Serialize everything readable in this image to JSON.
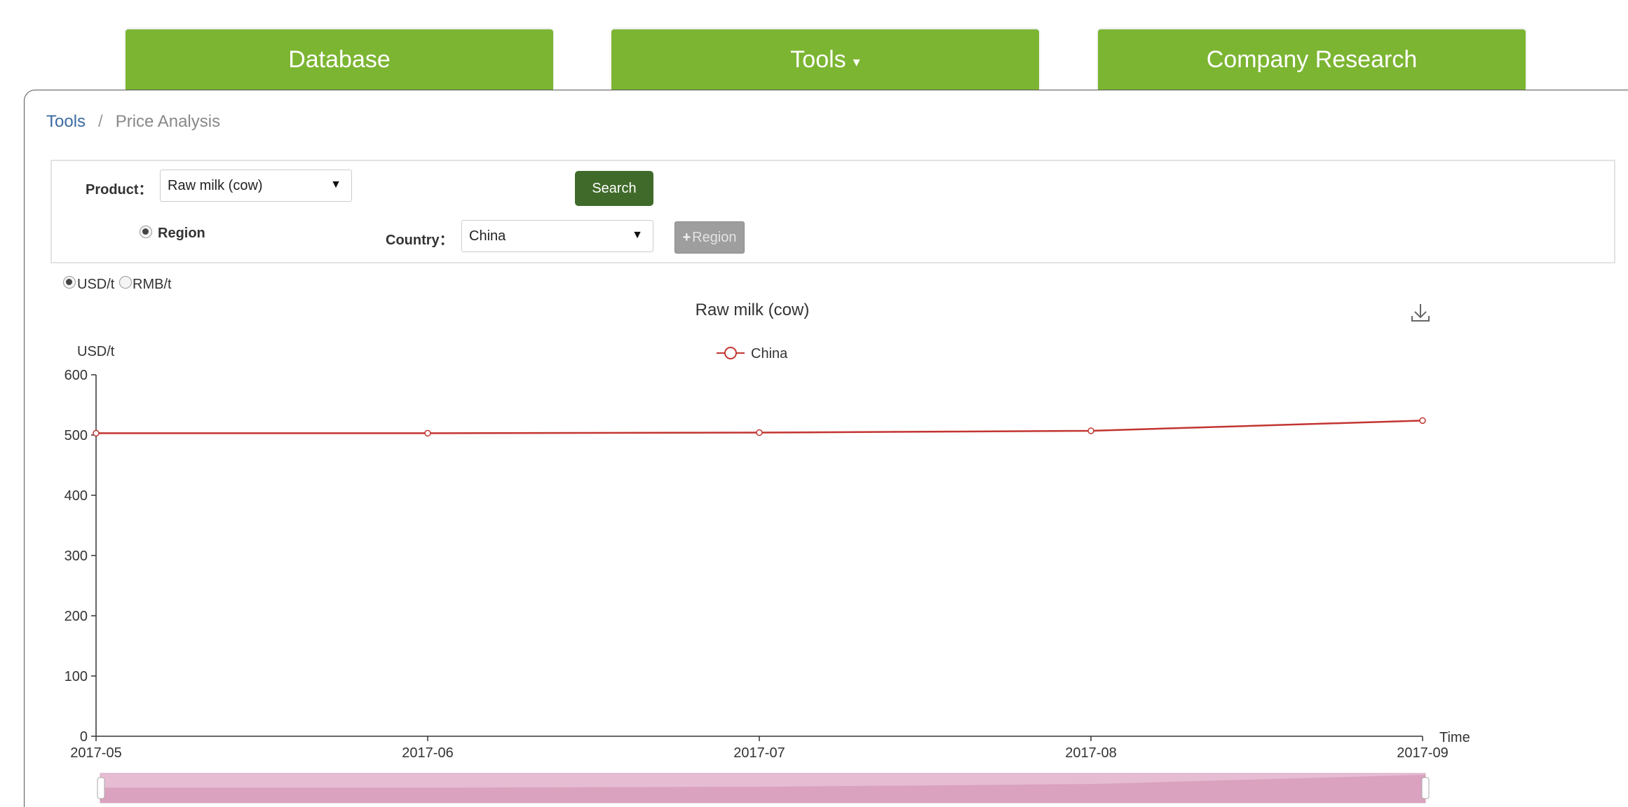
{
  "nav": {
    "database": "Database",
    "tools": "Tools",
    "company_research": "Company Research"
  },
  "breadcrumb": {
    "parent": "Tools",
    "separator": "/",
    "current": "Price Analysis"
  },
  "filters": {
    "product_label": "Product：",
    "product_value": "Raw milk (cow)",
    "search_button": "Search",
    "region_label": "Region",
    "country_label": "Country：",
    "country_value": "China",
    "add_region_button": "Region"
  },
  "units": {
    "usd": "USD/t",
    "rmb": "RMB/t",
    "selected": "USD/t"
  },
  "colors": {
    "nav_green": "#7cb532",
    "search_green": "#3f6a2a",
    "series_red": "#c23531",
    "zoom_fill": "#e6bcd3"
  },
  "chart_data": {
    "type": "line",
    "title": "Raw milk (cow)",
    "xlabel": "Time",
    "ylabel": "USD/t",
    "categories": [
      "2017-05",
      "2017-06",
      "2017-07",
      "2017-08",
      "2017-09"
    ],
    "series": [
      {
        "name": "China",
        "values": [
          503,
          503,
          504,
          507,
          524
        ],
        "color": "#c23531"
      }
    ],
    "ylim": [
      0,
      600
    ],
    "yticks": [
      0,
      100,
      200,
      300,
      400,
      500,
      600
    ],
    "legend": "top-center",
    "grid": false
  }
}
